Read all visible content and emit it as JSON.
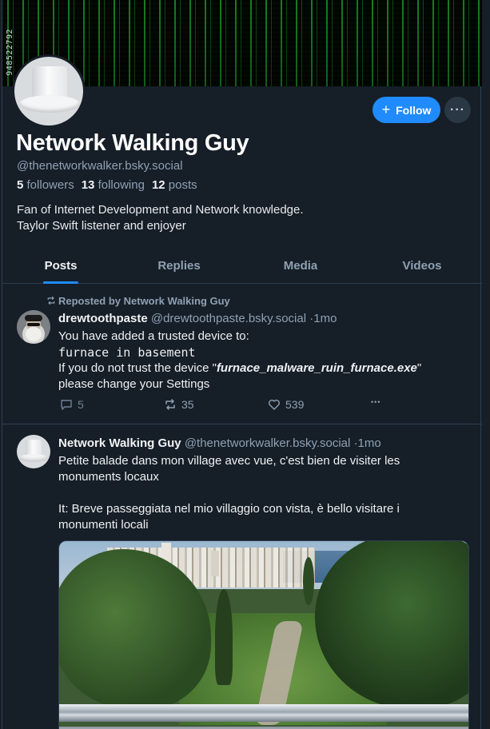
{
  "banner": {
    "stamp_text": "948522792"
  },
  "profile": {
    "display_name": "Network Walking Guy",
    "handle": "@thenetworkwalker.bsky.social",
    "followers_count": "5",
    "followers_label": "followers",
    "following_count": "13",
    "following_label": "following",
    "posts_count": "12",
    "posts_label": "posts",
    "bio_line1": "Fan of Internet Development and Network knowledge.",
    "bio_line2": "Taylor Swift listener and enjoyer"
  },
  "actions": {
    "follow_label": "Follow",
    "more_label": "···"
  },
  "tabs": [
    {
      "label": "Posts",
      "active": true
    },
    {
      "label": "Replies",
      "active": false
    },
    {
      "label": "Media",
      "active": false
    },
    {
      "label": "Videos",
      "active": false
    }
  ],
  "posts": [
    {
      "repost_text": "Reposted by Network Walking Guy",
      "author": "drewtoothpaste",
      "handle": "@drewtoothpaste.bsky.social",
      "separator": "·",
      "time": "1mo",
      "line1": "You have added a trusted device to:",
      "device": "furnace in basement",
      "line3_prefix": "If you do not trust the device \"",
      "line3_file": "furnace_malware_ruin_furnace.exe",
      "line3_suffix": "\"",
      "line4": "please change your Settings",
      "reply_count": "5",
      "repost_count": "35",
      "like_count": "539",
      "more_label": "•••"
    },
    {
      "author": "Network Walking Guy",
      "handle": "@thenetworkwalker.bsky.social",
      "separator": "·",
      "time": "1mo",
      "line1": "Petite balade dans mon village avec vue, c'est bien de visiter les",
      "line2": "monuments locaux",
      "line3": "It: Breve passeggiata nel mio villaggio con vista, è bello visitare i",
      "line4": "monumenti locali"
    }
  ],
  "colors": {
    "background": "#161e27",
    "accent": "#208bfe",
    "muted_text": "#8fa1b3",
    "border": "#2e4052"
  }
}
